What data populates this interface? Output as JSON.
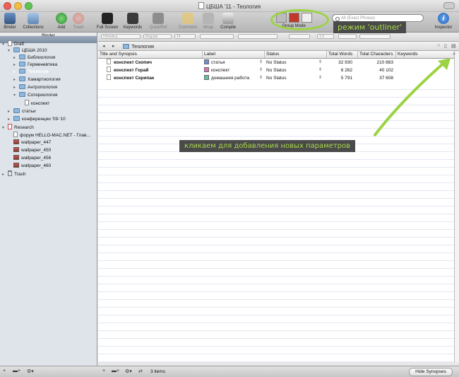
{
  "window": {
    "title": "ЦБША '11 - Теология"
  },
  "toolbar": {
    "binder": "Binder",
    "collections": "Collections",
    "add": "Add",
    "trash": "Trash",
    "full_screen": "Full Screen",
    "keywords": "Keywords",
    "quickref": "QuickRef",
    "comment": "Comment",
    "wrap": "Wrap",
    "compile": "Compile",
    "group_mode": "Group Mode",
    "search_placeholder": "All (Exact Phrase)",
    "inspector": "Inspector"
  },
  "format": {
    "font": "Helvetica",
    "style": "Regular",
    "size": "14",
    "spacing": "1.0"
  },
  "binder": {
    "header": "Binder",
    "items": [
      {
        "label": "Draft",
        "icon": "draft-icon"
      },
      {
        "label": "ЦБША 2010",
        "icon": "folder-icon"
      },
      {
        "label": "Библиология",
        "icon": "folder-icon"
      },
      {
        "label": "Герменевтика",
        "icon": "folder-icon"
      },
      {
        "label": "Теология",
        "icon": "folder-icon"
      },
      {
        "label": "Хамартиология",
        "icon": "folder-icon"
      },
      {
        "label": "Антропология",
        "icon": "folder-icon"
      },
      {
        "label": "Сотериология",
        "icon": "folder-icon"
      },
      {
        "label": "конспект",
        "icon": "page-icon"
      },
      {
        "label": "статьи",
        "icon": "folder-icon"
      },
      {
        "label": "конференции '09-'10",
        "icon": "folder-icon"
      },
      {
        "label": "Research",
        "icon": "research-icon"
      },
      {
        "label": "форум HELLO-MAC.NET - Глав...",
        "icon": "page-icon"
      },
      {
        "label": "wallpaper_447",
        "icon": "image-icon"
      },
      {
        "label": "wallpaper_450",
        "icon": "image-icon"
      },
      {
        "label": "wallpaper_456",
        "icon": "image-icon"
      },
      {
        "label": "wallpaper_460",
        "icon": "image-icon"
      },
      {
        "label": "Trash",
        "icon": "trash-icon"
      }
    ]
  },
  "editor": {
    "breadcrumb": "Теология",
    "back": "◂",
    "forward": "▸"
  },
  "outliner": {
    "columns": [
      "Title and Synopsis",
      "Label",
      "Status",
      "Total Words",
      "Total Characters",
      "Keywords"
    ],
    "rows": [
      {
        "title": "конспект Скопич",
        "label": "статья",
        "label_color": "#6e8ed8",
        "status": "No Status",
        "words": "32 930",
        "chars": "210 883"
      },
      {
        "title": "конспект Горай",
        "label": "конспект",
        "label_color": "#d873b8",
        "status": "No Status",
        "words": "6 262",
        "chars": "40 102"
      },
      {
        "title": "конспект Скрипак",
        "label": "домашняя работа",
        "label_color": "#63c2a6",
        "status": "No Status",
        "words": "5 791",
        "chars": "37 608"
      }
    ]
  },
  "bottom": {
    "items": "3 items",
    "hide_synopses": "Hide Synopses"
  },
  "annotations": {
    "outliner_mode": "режим 'outliner'",
    "add_params": "кликаем для добавления новых параметров"
  }
}
